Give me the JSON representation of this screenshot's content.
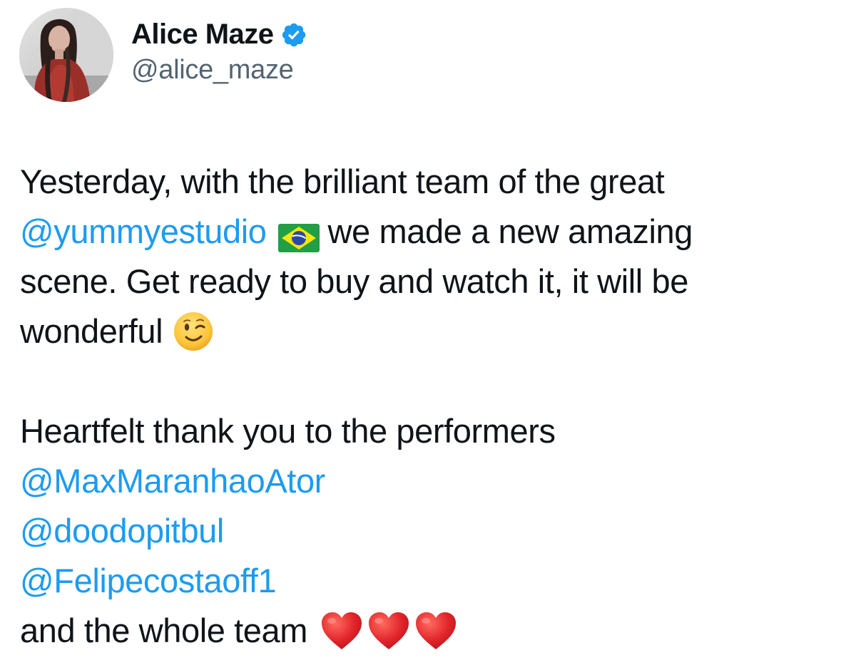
{
  "author": {
    "display_name": "Alice Maze",
    "handle": "@alice_maze",
    "verified": true,
    "avatar": "profile-photo"
  },
  "tweet": {
    "line1": "Yesterday, with the brilliant team of the great",
    "mention_studio": "@yummyestudio",
    "flag_emoji": "brazil-flag-icon",
    "line2_rest": "we made a new amazing",
    "line3": "scene. Get ready to buy and watch it, it will be",
    "line4": "wonderful",
    "wink_emoji": "winking-face-icon",
    "line5": "Heartfelt thank you to the performers",
    "mentions": [
      "@MaxMaranhaoAtor",
      "@doodopitbul",
      "@Felipecostaoff1"
    ],
    "line_last": "and the whole team",
    "heart_emojis": [
      "red-heart-icon",
      "red-heart-icon",
      "red-heart-icon"
    ]
  },
  "colors": {
    "text": "#0f1419",
    "secondary": "#536471",
    "link": "#1d9bf0",
    "verified": "#1d9bf0",
    "heart": "#e0242a"
  }
}
